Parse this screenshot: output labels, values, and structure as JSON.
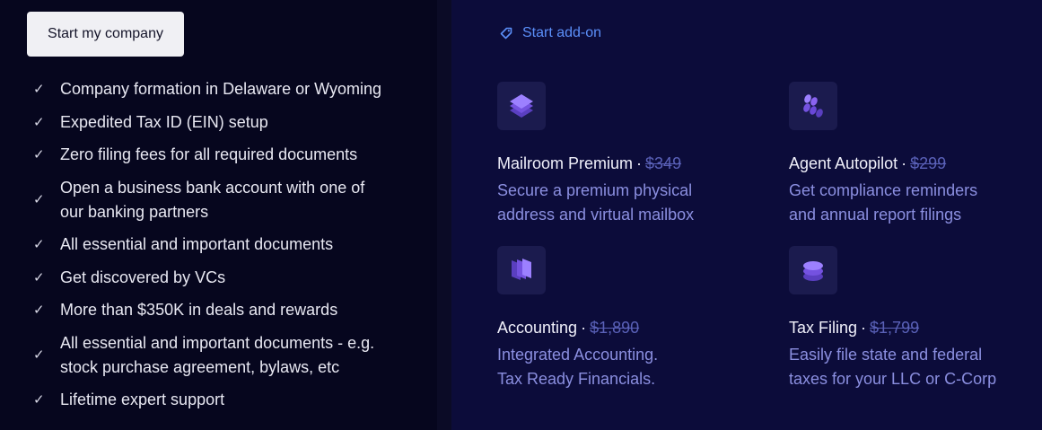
{
  "left": {
    "start_button": "Start my company",
    "features": [
      {
        "lines": [
          "Company formation in Delaware or Wyoming"
        ]
      },
      {
        "lines": [
          "Expedited Tax ID (EIN) setup"
        ]
      },
      {
        "lines": [
          "Zero filing fees for all required documents"
        ]
      },
      {
        "lines": [
          "Open a business bank account with one of",
          "our banking partners"
        ]
      },
      {
        "lines": [
          "All essential and important documents"
        ]
      },
      {
        "lines": [
          "Get discovered by VCs"
        ]
      },
      {
        "lines": [
          "More than $350K in deals and rewards"
        ]
      },
      {
        "lines": [
          "All essential and important documents - e.g.",
          "stock purchase agreement, bylaws, etc"
        ]
      },
      {
        "lines": [
          "Lifetime expert support"
        ]
      }
    ]
  },
  "right": {
    "addon_link": "Start add-on",
    "cards": [
      {
        "title": "Mailroom Premium",
        "price": "$349",
        "desc": [
          "Secure a premium physical",
          "address and virtual mailbox"
        ],
        "icon": "mail-stack-icon"
      },
      {
        "title": "Agent Autopilot",
        "price": "$299",
        "desc": [
          "Get compliance reminders",
          "and annual report filings"
        ],
        "icon": "agent-icon"
      },
      {
        "title": "Accounting",
        "price": "$1,890",
        "desc": [
          "Integrated Accounting.",
          "Tax Ready Financials."
        ],
        "icon": "documents-icon"
      },
      {
        "title": "Tax Filing",
        "price": "$1,799",
        "desc": [
          "Easily file state and federal",
          "taxes for your LLC or C-Corp"
        ],
        "icon": "coin-stack-icon"
      }
    ]
  },
  "colors": {
    "accent_link": "#5b8ff9",
    "card_desc": "#8b8fe0",
    "strike_price": "#5a61b8",
    "icon_purple": "#8a63f0"
  }
}
